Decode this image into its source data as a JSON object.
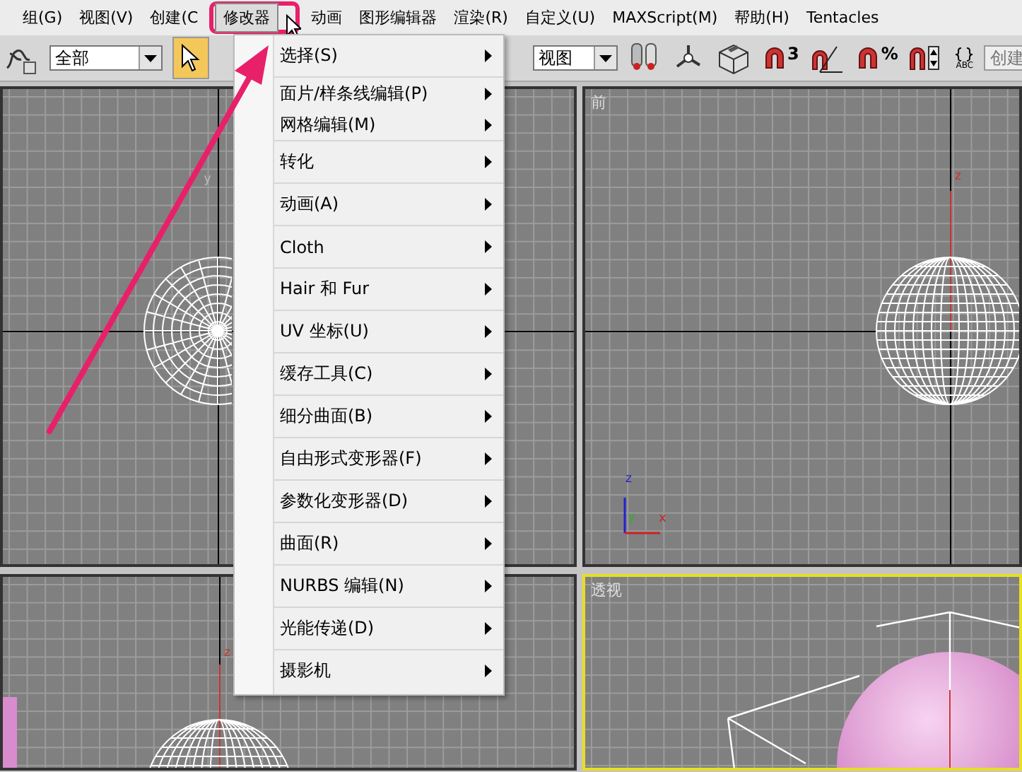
{
  "menu_bar": {
    "items": [
      {
        "label": "组(G)",
        "selected": false
      },
      {
        "label": "视图(V)",
        "selected": false
      },
      {
        "label": "创建(C",
        "selected": false
      },
      {
        "label": "修改器",
        "selected": true
      },
      {
        "label": "动画",
        "selected": false
      },
      {
        "label": "图形编辑器",
        "selected": false
      },
      {
        "label": "渲染(R)",
        "selected": false
      },
      {
        "label": "自定义(U)",
        "selected": false
      },
      {
        "label": "MAXScript(M)",
        "selected": false
      },
      {
        "label": "帮助(H)",
        "selected": false
      },
      {
        "label": "Tentacles",
        "selected": false
      }
    ]
  },
  "toolbar": {
    "selection_filter": "全部",
    "select_tool_selected": true,
    "view_dropdown": "视图",
    "snap_badges": [
      "3",
      "%"
    ],
    "abc_label": "ABC",
    "named_selection_field": "创建"
  },
  "dropdown_menu": {
    "groups": [
      [
        {
          "label": "选择(S)",
          "has_submenu": true
        }
      ],
      [
        {
          "label": "面片/样条线编辑(P)",
          "has_submenu": true
        },
        {
          "label": "网格编辑(M)",
          "has_submenu": true
        }
      ],
      [
        {
          "label": "转化",
          "has_submenu": true
        }
      ],
      [
        {
          "label": "动画(A)",
          "has_submenu": true
        }
      ],
      [
        {
          "label": "Cloth",
          "has_submenu": true
        }
      ],
      [
        {
          "label": "Hair 和 Fur",
          "has_submenu": true
        }
      ],
      [
        {
          "label": "UV 坐标(U)",
          "has_submenu": true
        }
      ],
      [
        {
          "label": "缓存工具(C)",
          "has_submenu": true
        }
      ],
      [
        {
          "label": "细分曲面(B)",
          "has_submenu": true
        }
      ],
      [
        {
          "label": "自由形式变形器(F)",
          "has_submenu": true
        }
      ],
      [
        {
          "label": "参数化变形器(D)",
          "has_submenu": true
        }
      ],
      [
        {
          "label": "曲面(R)",
          "has_submenu": true
        }
      ],
      [
        {
          "label": "NURBS 编辑(N)",
          "has_submenu": true
        }
      ],
      [
        {
          "label": "光能传递(D)",
          "has_submenu": true
        }
      ],
      [
        {
          "label": "摄影机",
          "has_submenu": true
        }
      ]
    ]
  },
  "viewports": [
    {
      "kind": "top",
      "active": false,
      "axis_label": "y"
    },
    {
      "kind": "front",
      "active": false,
      "label": "前",
      "axis_label": "z",
      "tripod": [
        "z",
        "y",
        "x"
      ]
    },
    {
      "kind": "left",
      "active": false,
      "axis_label": "z"
    },
    {
      "kind": "perspective",
      "active": true,
      "label": "透视"
    }
  ]
}
